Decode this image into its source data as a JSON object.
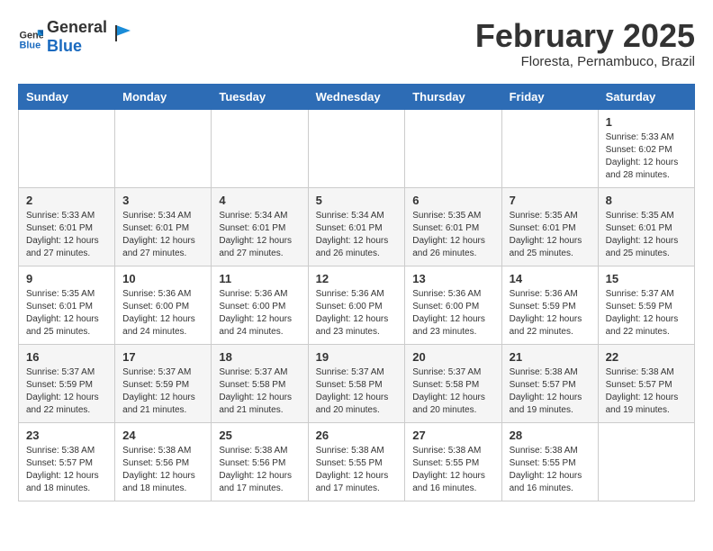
{
  "header": {
    "logo_general": "General",
    "logo_blue": "Blue",
    "month": "February 2025",
    "location": "Floresta, Pernambuco, Brazil"
  },
  "weekdays": [
    "Sunday",
    "Monday",
    "Tuesday",
    "Wednesday",
    "Thursday",
    "Friday",
    "Saturday"
  ],
  "weeks": [
    [
      {
        "day": "",
        "info": ""
      },
      {
        "day": "",
        "info": ""
      },
      {
        "day": "",
        "info": ""
      },
      {
        "day": "",
        "info": ""
      },
      {
        "day": "",
        "info": ""
      },
      {
        "day": "",
        "info": ""
      },
      {
        "day": "1",
        "info": "Sunrise: 5:33 AM\nSunset: 6:02 PM\nDaylight: 12 hours\nand 28 minutes."
      }
    ],
    [
      {
        "day": "2",
        "info": "Sunrise: 5:33 AM\nSunset: 6:01 PM\nDaylight: 12 hours\nand 27 minutes."
      },
      {
        "day": "3",
        "info": "Sunrise: 5:34 AM\nSunset: 6:01 PM\nDaylight: 12 hours\nand 27 minutes."
      },
      {
        "day": "4",
        "info": "Sunrise: 5:34 AM\nSunset: 6:01 PM\nDaylight: 12 hours\nand 27 minutes."
      },
      {
        "day": "5",
        "info": "Sunrise: 5:34 AM\nSunset: 6:01 PM\nDaylight: 12 hours\nand 26 minutes."
      },
      {
        "day": "6",
        "info": "Sunrise: 5:35 AM\nSunset: 6:01 PM\nDaylight: 12 hours\nand 26 minutes."
      },
      {
        "day": "7",
        "info": "Sunrise: 5:35 AM\nSunset: 6:01 PM\nDaylight: 12 hours\nand 25 minutes."
      },
      {
        "day": "8",
        "info": "Sunrise: 5:35 AM\nSunset: 6:01 PM\nDaylight: 12 hours\nand 25 minutes."
      }
    ],
    [
      {
        "day": "9",
        "info": "Sunrise: 5:35 AM\nSunset: 6:01 PM\nDaylight: 12 hours\nand 25 minutes."
      },
      {
        "day": "10",
        "info": "Sunrise: 5:36 AM\nSunset: 6:00 PM\nDaylight: 12 hours\nand 24 minutes."
      },
      {
        "day": "11",
        "info": "Sunrise: 5:36 AM\nSunset: 6:00 PM\nDaylight: 12 hours\nand 24 minutes."
      },
      {
        "day": "12",
        "info": "Sunrise: 5:36 AM\nSunset: 6:00 PM\nDaylight: 12 hours\nand 23 minutes."
      },
      {
        "day": "13",
        "info": "Sunrise: 5:36 AM\nSunset: 6:00 PM\nDaylight: 12 hours\nand 23 minutes."
      },
      {
        "day": "14",
        "info": "Sunrise: 5:36 AM\nSunset: 5:59 PM\nDaylight: 12 hours\nand 22 minutes."
      },
      {
        "day": "15",
        "info": "Sunrise: 5:37 AM\nSunset: 5:59 PM\nDaylight: 12 hours\nand 22 minutes."
      }
    ],
    [
      {
        "day": "16",
        "info": "Sunrise: 5:37 AM\nSunset: 5:59 PM\nDaylight: 12 hours\nand 22 minutes."
      },
      {
        "day": "17",
        "info": "Sunrise: 5:37 AM\nSunset: 5:59 PM\nDaylight: 12 hours\nand 21 minutes."
      },
      {
        "day": "18",
        "info": "Sunrise: 5:37 AM\nSunset: 5:58 PM\nDaylight: 12 hours\nand 21 minutes."
      },
      {
        "day": "19",
        "info": "Sunrise: 5:37 AM\nSunset: 5:58 PM\nDaylight: 12 hours\nand 20 minutes."
      },
      {
        "day": "20",
        "info": "Sunrise: 5:37 AM\nSunset: 5:58 PM\nDaylight: 12 hours\nand 20 minutes."
      },
      {
        "day": "21",
        "info": "Sunrise: 5:38 AM\nSunset: 5:57 PM\nDaylight: 12 hours\nand 19 minutes."
      },
      {
        "day": "22",
        "info": "Sunrise: 5:38 AM\nSunset: 5:57 PM\nDaylight: 12 hours\nand 19 minutes."
      }
    ],
    [
      {
        "day": "23",
        "info": "Sunrise: 5:38 AM\nSunset: 5:57 PM\nDaylight: 12 hours\nand 18 minutes."
      },
      {
        "day": "24",
        "info": "Sunrise: 5:38 AM\nSunset: 5:56 PM\nDaylight: 12 hours\nand 18 minutes."
      },
      {
        "day": "25",
        "info": "Sunrise: 5:38 AM\nSunset: 5:56 PM\nDaylight: 12 hours\nand 17 minutes."
      },
      {
        "day": "26",
        "info": "Sunrise: 5:38 AM\nSunset: 5:55 PM\nDaylight: 12 hours\nand 17 minutes."
      },
      {
        "day": "27",
        "info": "Sunrise: 5:38 AM\nSunset: 5:55 PM\nDaylight: 12 hours\nand 16 minutes."
      },
      {
        "day": "28",
        "info": "Sunrise: 5:38 AM\nSunset: 5:55 PM\nDaylight: 12 hours\nand 16 minutes."
      },
      {
        "day": "",
        "info": ""
      }
    ]
  ]
}
